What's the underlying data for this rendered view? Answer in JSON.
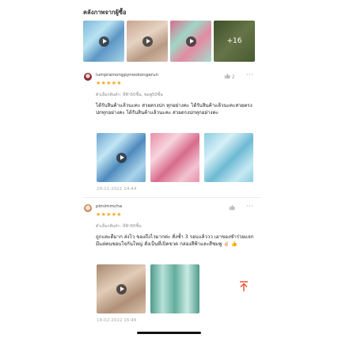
{
  "section": {
    "title": "คลังภาพจากผู้ซื้อ"
  },
  "gallery": {
    "more_count": "+16"
  },
  "reviews": [
    {
      "username": "lumprainongpynookongarun",
      "stars": "★★★★★",
      "likes": "2",
      "variant": "ตัวเลือกสินค้า: สีฟ้า50ชิ้น, ชมพู50ชิ้น",
      "text": "ได้รับสินค้าแล้วนะคะ สวยตรงปก ทุกอย่างคะ ได้รับสินค้าแล้วนะคะสวยตรงปกทุกอย่างคะ ได้รับสินค้าแล้วนะคะ สวยตรงปกทุกอย่างคะ",
      "date": "29-11-2021 14:44"
    },
    {
      "username": "pimimmcha",
      "stars": "★★★★★",
      "variant": "ตัวเลือกสินค้า: สีฟ้า50ชิ้น",
      "text": "ถูกและดีมาก ส่งไว ของถึงไวมากค่ะ สั่งซ้ำ 3 รอบแล้ววว เอาของชำร่วยแจก มีแต่คนชอบใจกันใหญ่ สั่งเป็นที่เปิดขวด กล่องสีฟ้าและสีชมพู ✌🏻 👍",
      "date": "18-02-2022 16:46"
    }
  ],
  "icons": {
    "play": "play-icon",
    "like": "thumbs-up-icon",
    "more": "more-dots-icon",
    "scroll_top": "arrow-up-icon"
  },
  "colors": {
    "stars": "#f6a623",
    "accent": "#ee4d2d"
  }
}
